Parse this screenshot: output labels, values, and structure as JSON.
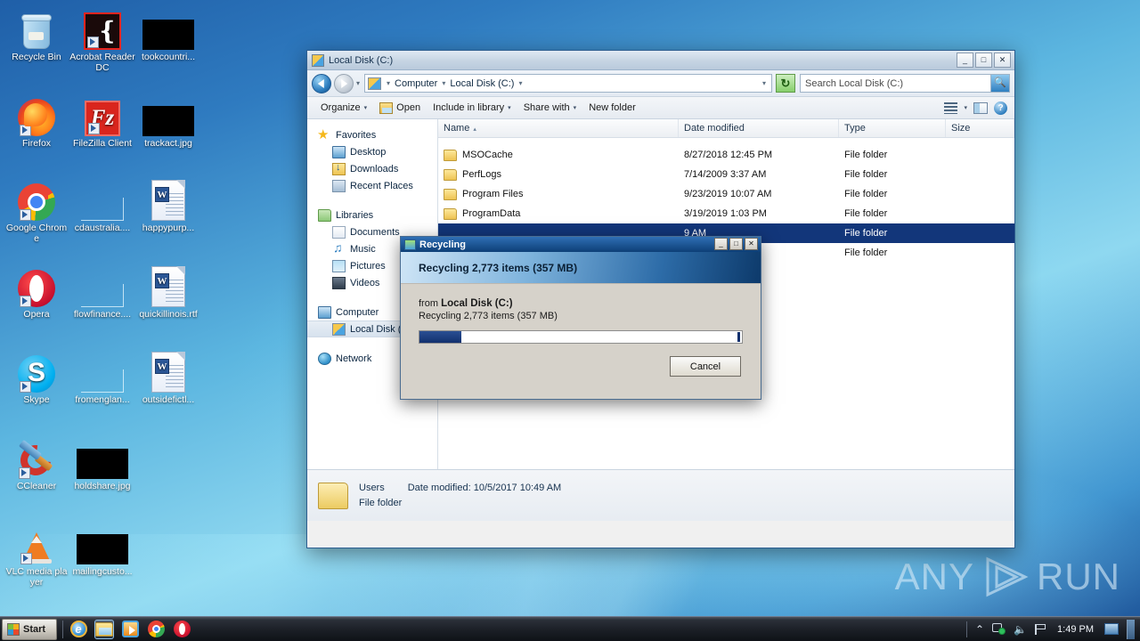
{
  "desktop": {
    "icons": [
      {
        "label": "Recycle Bin",
        "kind": "recycle-bin"
      },
      {
        "label": "Acrobat Reader DC",
        "kind": "acrobat"
      },
      {
        "label": "tookcountri...",
        "kind": "blackbox"
      },
      {
        "label": "Firefox",
        "kind": "firefox"
      },
      {
        "label": "FileZilla Client",
        "kind": "filezilla"
      },
      {
        "label": "trackact.jpg",
        "kind": "blackbox"
      },
      {
        "label": "Google Chrome",
        "kind": "chrome"
      },
      {
        "label": "cdaustralia....",
        "kind": "thinline"
      },
      {
        "label": "happypurp...",
        "kind": "word-doc"
      },
      {
        "label": "Opera",
        "kind": "opera"
      },
      {
        "label": "flowfinance....",
        "kind": "thinline"
      },
      {
        "label": "quickillinois.rtf",
        "kind": "word-doc"
      },
      {
        "label": "Skype",
        "kind": "skype"
      },
      {
        "label": "fromenglan...",
        "kind": "thinline"
      },
      {
        "label": "outsidefictl...",
        "kind": "word-doc"
      },
      {
        "label": "CCleaner",
        "kind": "ccleaner"
      },
      {
        "label": "holdshare.jpg",
        "kind": "blackbox"
      },
      {
        "label": "VLC media player",
        "kind": "vlc"
      },
      {
        "label": "mailingcusto...",
        "kind": "blackbox"
      }
    ]
  },
  "explorer": {
    "title": "Local Disk (C:)",
    "window_buttons": {
      "minimize": "_",
      "maximize": "□",
      "close": "✕"
    },
    "breadcrumb": {
      "items": [
        "Computer",
        "Local Disk (C:)"
      ],
      "separator": "▸",
      "dropdown": "▾"
    },
    "search": {
      "placeholder": "Search Local Disk (C:)",
      "value": "",
      "icon": "search-icon"
    },
    "refresh_icon": "refresh-icon",
    "toolbar": {
      "organize": "Organize",
      "open": "Open",
      "include_in_library": "Include in library",
      "share_with": "Share with",
      "new_folder": "New folder",
      "caret": "▾",
      "view_icon": "view-list-icon",
      "preview_pane_icon": "preview-pane-icon",
      "help_icon": "help-icon"
    },
    "sidebar": {
      "groups": [
        {
          "header": {
            "label": "Favorites",
            "icon": "star-icon"
          },
          "items": [
            {
              "label": "Desktop",
              "icon": "desktop-icon"
            },
            {
              "label": "Downloads",
              "icon": "downloads-icon"
            },
            {
              "label": "Recent Places",
              "icon": "recent-places-icon"
            }
          ]
        },
        {
          "header": {
            "label": "Libraries",
            "icon": "libraries-icon"
          },
          "items": [
            {
              "label": "Documents",
              "icon": "documents-icon"
            },
            {
              "label": "Music",
              "icon": "music-icon"
            },
            {
              "label": "Pictures",
              "icon": "pictures-icon"
            },
            {
              "label": "Videos",
              "icon": "videos-icon"
            }
          ]
        },
        {
          "header": {
            "label": "Computer",
            "icon": "computer-icon"
          },
          "items": [
            {
              "label": "Local Disk (",
              "icon": "local-disk-icon",
              "selected": true
            }
          ]
        },
        {
          "header": {
            "label": "Network",
            "icon": "network-icon"
          },
          "items": []
        }
      ]
    },
    "columns": [
      {
        "label": "Name",
        "sort": "▴"
      },
      {
        "label": "Date modified",
        "sort": ""
      },
      {
        "label": "Type",
        "sort": ""
      },
      {
        "label": "Size",
        "sort": ""
      }
    ],
    "rows": [
      {
        "name": "MSOCache",
        "date": "8/27/2018 12:45 PM",
        "type": "File folder",
        "size": "",
        "selected": false
      },
      {
        "name": "PerfLogs",
        "date": "7/14/2009 3:37 AM",
        "type": "File folder",
        "size": "",
        "selected": false
      },
      {
        "name": "Program Files",
        "date": "9/23/2019 10:07 AM",
        "type": "File folder",
        "size": "",
        "selected": false
      },
      {
        "name": "ProgramData",
        "date": "3/19/2019 1:03 PM",
        "type": "File folder",
        "size": "",
        "selected": false
      },
      {
        "name": "",
        "date": "9 AM",
        "type": "File folder",
        "size": "",
        "selected": true
      },
      {
        "name": "",
        "date": "5 PM",
        "type": "File folder",
        "size": "",
        "selected": false
      }
    ],
    "status": {
      "name": "Users",
      "date_label": "Date modified:",
      "date_value": "10/5/2017 10:49 AM",
      "type": "File folder"
    }
  },
  "dialog": {
    "title": "Recycling",
    "title_icon": "recycling-icon",
    "buttons": {
      "minimize": "_",
      "maximize": "□",
      "close": "✕"
    },
    "header": "Recycling 2,773 items (357 MB)",
    "from_label": "from",
    "from_value": "Local Disk (C:)",
    "detail": "Recycling 2,773 items (357 MB)",
    "progress_percent": 13,
    "cancel": "Cancel"
  },
  "watermark": {
    "text_left": "ANY",
    "text_right": "RUN",
    "logo": "play-triangle-logo"
  },
  "taskbar": {
    "start": "Start",
    "start_icon": "windows-orb-icon",
    "quick_launch": [
      {
        "name": "internet-explorer-icon",
        "active": false
      },
      {
        "name": "windows-explorer-icon",
        "active": true
      },
      {
        "name": "windows-media-player-icon",
        "active": false
      },
      {
        "name": "chrome-icon",
        "active": false
      },
      {
        "name": "opera-icon",
        "active": false
      }
    ],
    "tray": {
      "chevron": "⌃",
      "network_icon": "network-tray-icon",
      "volume_icon": "🔊",
      "action_center_icon": "flag-icon",
      "clock": "1:49 PM",
      "screen_icon": "screen-icon"
    }
  },
  "colors": {
    "selection_blue": "#12367a",
    "dialog_header_dark": "#0d3a6b",
    "progress_fill": "#12306e",
    "desktop_blue": "#2f7bc0"
  }
}
